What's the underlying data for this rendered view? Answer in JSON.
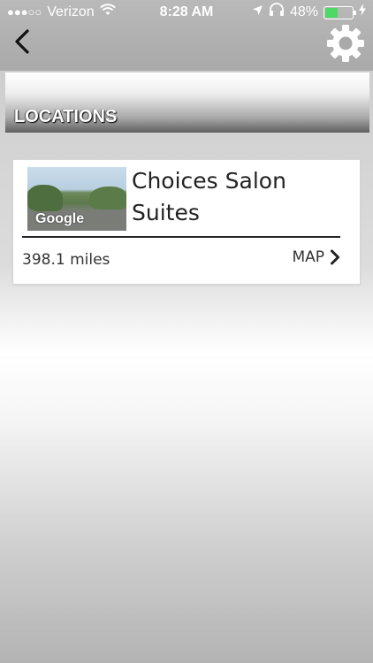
{
  "status_bar": {
    "signal_dots": "●●●○○",
    "carrier": "Verizon",
    "time": "8:28 AM",
    "battery": "48%",
    "battery_level": 0.48,
    "battery_color": "#4cd964"
  },
  "nav": {
    "back_icon": "chevron-left-icon",
    "settings_icon": "gear-icon"
  },
  "banner": {
    "title": "LOCATIONS"
  },
  "locations": [
    {
      "name": "Choices Salon Suites",
      "thumbnail_label": "Google",
      "distance": "398.1 miles",
      "map_label": "MAP"
    }
  ]
}
